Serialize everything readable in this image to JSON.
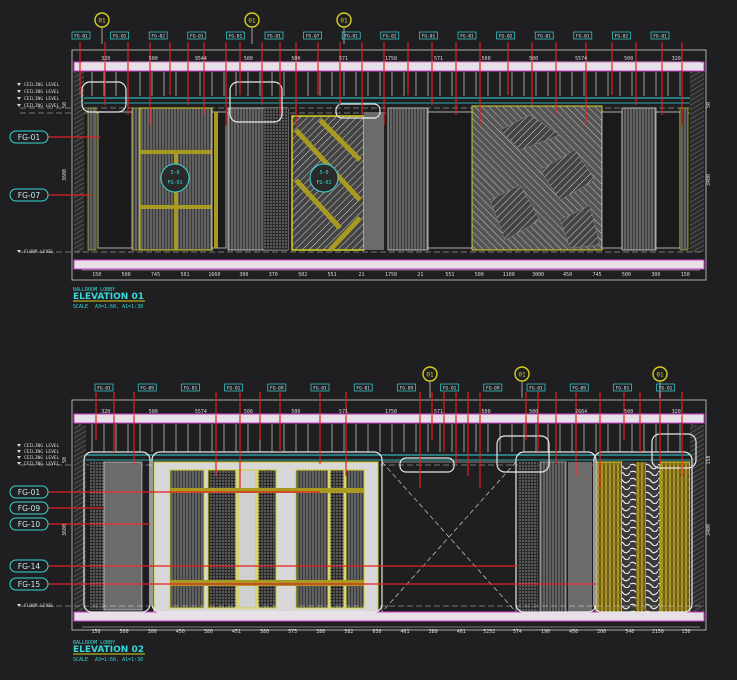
{
  "colors": {
    "background": "#1f1f22",
    "linework": "#d9d9d9",
    "magenta": "#d040d0",
    "cyan": "#38d8d8",
    "red": "#e02020",
    "yellow": "#d8d020",
    "olive": "#a89a20",
    "tag_text": "#c8e8f0"
  },
  "icons": {
    "section_marker": "circle-marker-icon",
    "material_tag": "rounded-tag-icon"
  },
  "elevations": [
    {
      "title_small": "BALLROOM LOBBY",
      "title": "ELEVATION 01",
      "scale_label": "SCALE",
      "scale_value": "A3=1:60, A1=1:30",
      "section_markers": [
        "01",
        "01",
        "01"
      ],
      "top_codes": [
        "FG-01",
        "FG-01",
        "FG-02",
        "FG-01",
        "FG-01",
        "FG-01",
        "FG-07",
        "FG-01",
        "FG-02",
        "FG-01",
        "FG-01",
        "FG-02",
        "FG-01",
        "FG-01",
        "FG-02",
        "FG-01"
      ],
      "top_dims": [
        "320",
        "500",
        "9544",
        "500",
        "500",
        "571",
        "1750",
        "571",
        "500",
        "500",
        "5574",
        "500",
        "320"
      ],
      "bottom_dims": [
        "150",
        "500",
        "745",
        "501",
        "1660",
        "300",
        "370",
        "502",
        "551",
        "21",
        "1750",
        "21",
        "551",
        "500",
        "1100",
        "3000",
        "450",
        "745",
        "500",
        "300",
        "150"
      ],
      "left_levels": [
        "CEILING LEVEL",
        "CEILING LEVEL",
        "CEILING LEVEL",
        "CEILING LEVEL",
        "FLOOR LEVEL"
      ],
      "left_tags": [
        "FG-01",
        "FG-07"
      ],
      "side_dims": [
        "3600",
        "50",
        "3400",
        "50"
      ],
      "inner_labels": [
        "5-0",
        "FG-01",
        "5-0",
        "FG-01"
      ]
    },
    {
      "title_small": "BALLROOM LOBBY",
      "title": "ELEVATION 02",
      "scale_label": "SCALE",
      "scale_value": "A3=1:60, A1=1:30",
      "section_markers": [
        "01",
        "01",
        "01"
      ],
      "top_codes": [
        "FG-01",
        "FG-09",
        "FG-01",
        "FG-01",
        "FG-09",
        "FG-01",
        "FG-01",
        "FG-09",
        "FG-01",
        "FG-09",
        "FG-01",
        "FG-09",
        "FG-01",
        "FG-01"
      ],
      "top_dims": [
        "320",
        "500",
        "5574",
        "500",
        "500",
        "571",
        "1750",
        "571",
        "500",
        "500",
        "2664",
        "500",
        "320"
      ],
      "bottom_dims": [
        "150",
        "500",
        "300",
        "450",
        "380",
        "451",
        "580",
        "575",
        "380",
        "582",
        "630",
        "461",
        "380",
        "461",
        "5252",
        "574",
        "190",
        "450",
        "200",
        "540",
        "2150",
        "130"
      ],
      "left_levels": [
        "CEILING LEVEL",
        "CEILING LEVEL",
        "CEILING LEVEL",
        "CEILING LEVEL",
        "FLOOR LEVEL"
      ],
      "left_tags": [
        "FG-01",
        "FG-09",
        "FG-10",
        "FG-14",
        "FG-15"
      ],
      "side_dims": [
        "3600",
        "50",
        "3400",
        "150"
      ]
    }
  ]
}
